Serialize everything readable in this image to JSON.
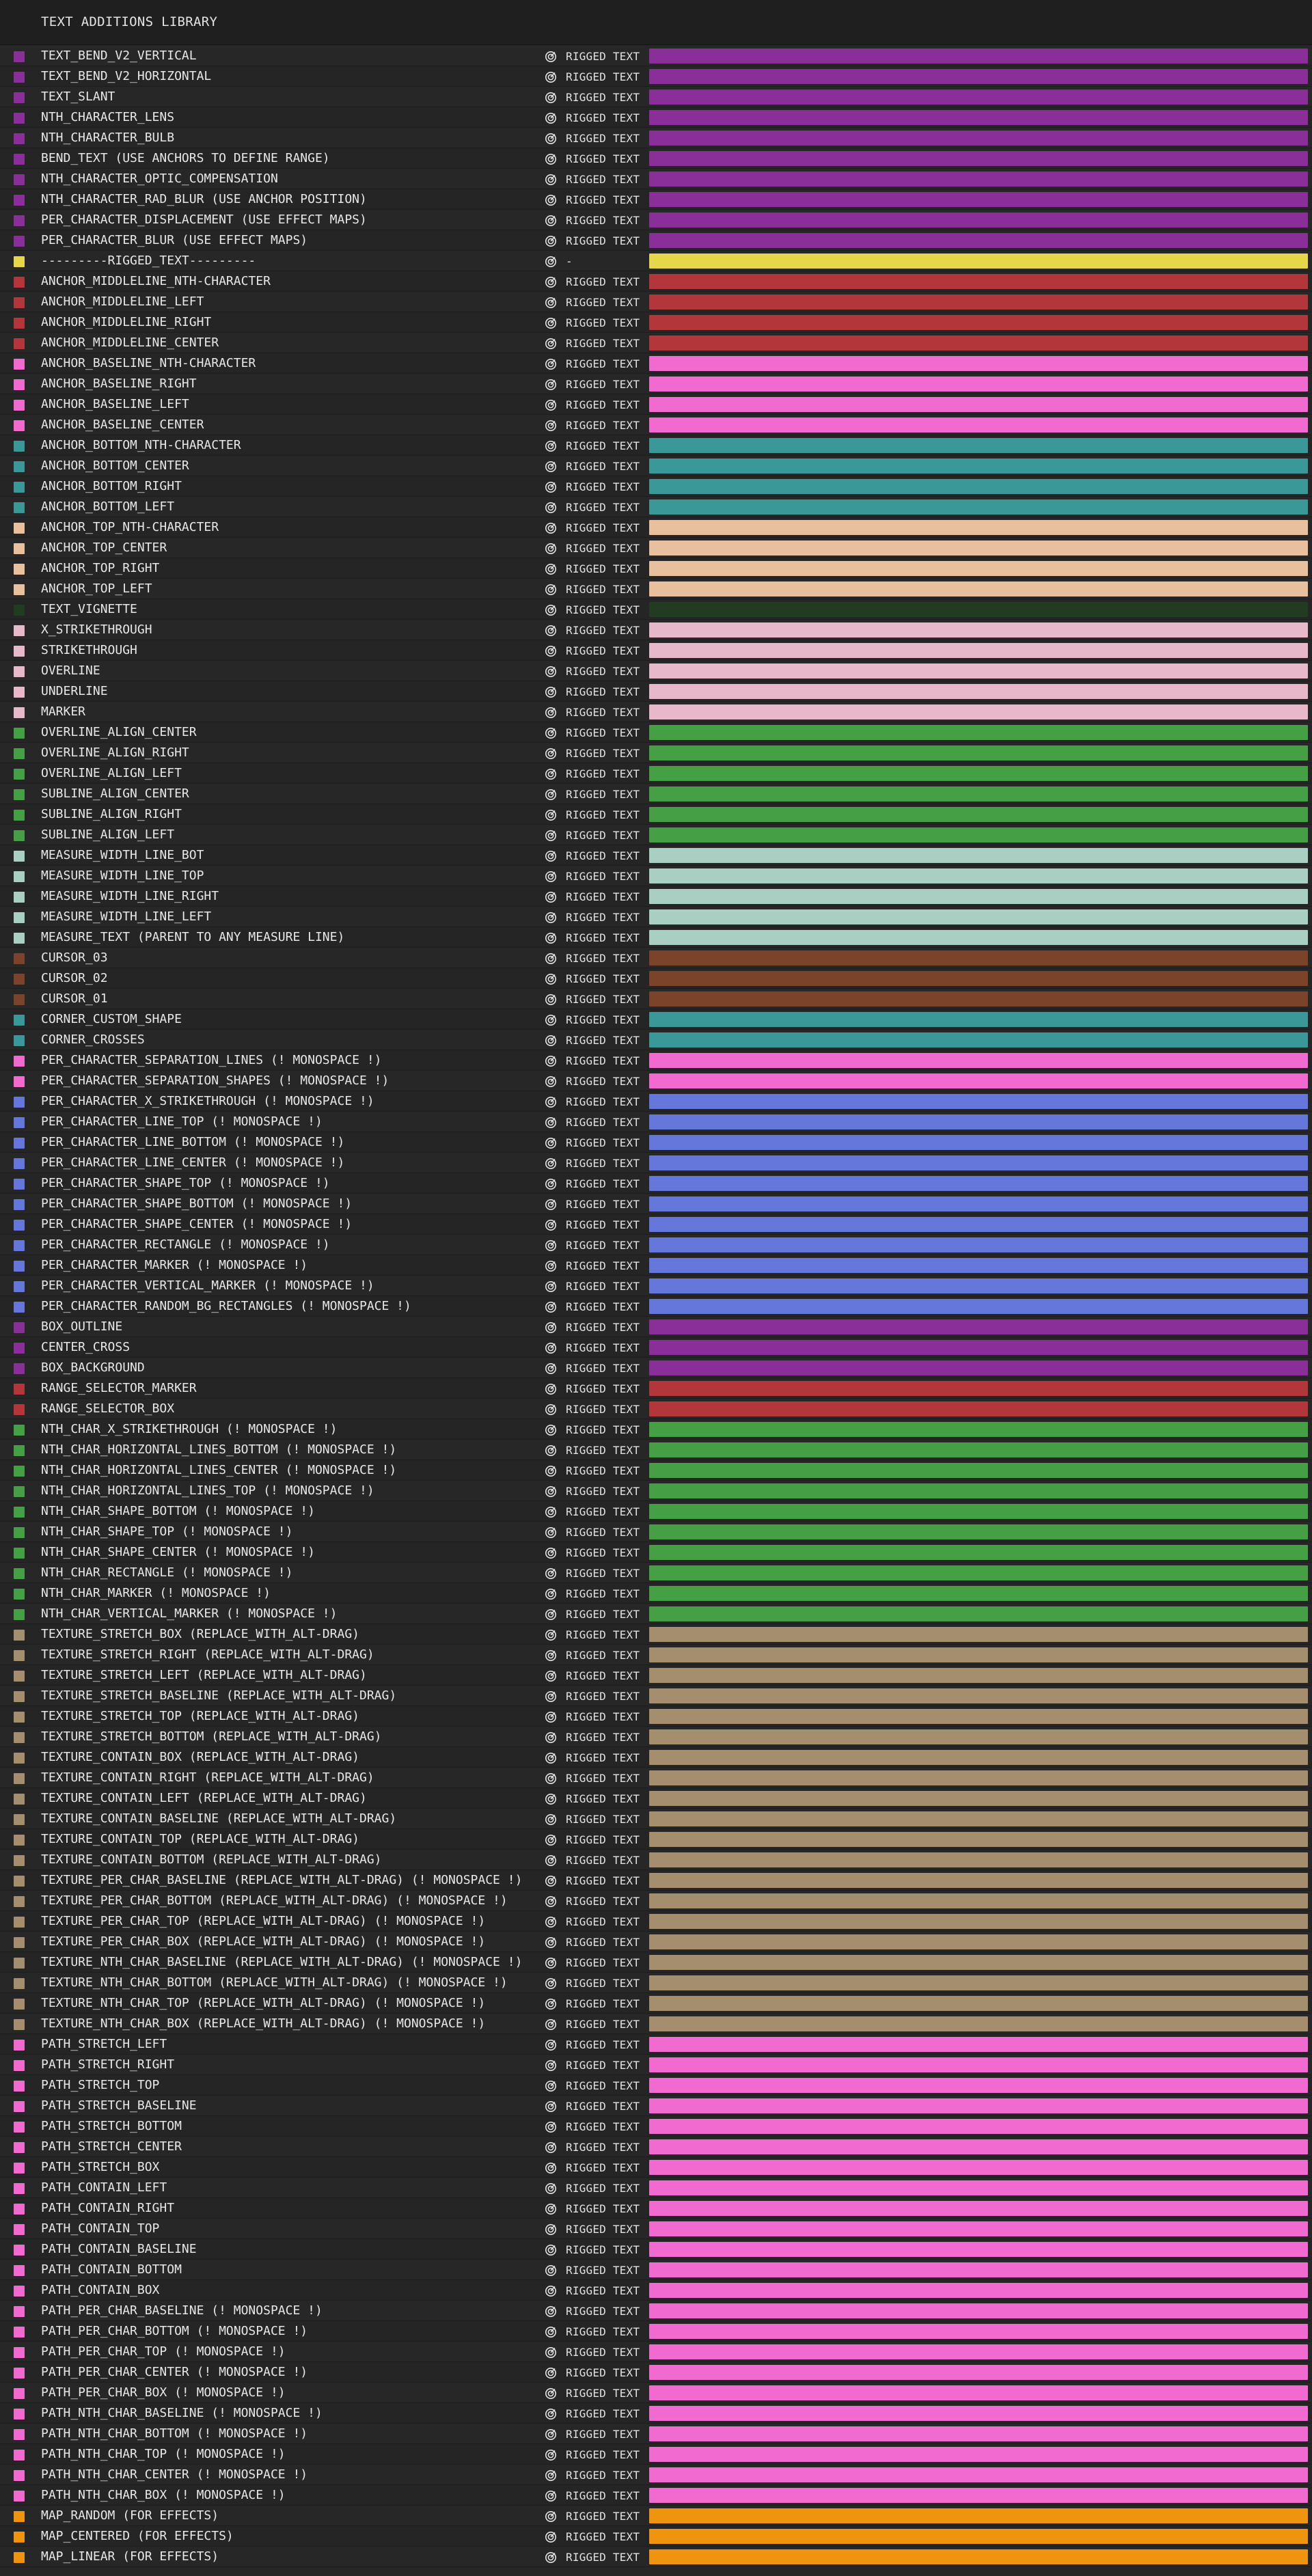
{
  "window": {
    "title": "TEXT ADDITIONS LIBRARY"
  },
  "palette": {
    "purple": "#8a2f9a",
    "yellow": "#e5d64a",
    "red": "#b3363a",
    "pink": "#f06ad0",
    "teal": "#3a9898",
    "peach": "#e9c09d",
    "darkgreen": "#213c21",
    "lightpink": "#e7b8c9",
    "green": "#45a045",
    "mint": "#a9cfc3",
    "brown": "#7b432a",
    "blue": "#6677dc",
    "tan": "#a58e6e",
    "orange": "#ee940f"
  },
  "items": [
    {
      "name": "TEXT_BEND_V2_VERTICAL",
      "type": "RIGGED TEXT",
      "color": "purple"
    },
    {
      "name": "TEXT_BEND_V2_HORIZONTAL",
      "type": "RIGGED TEXT",
      "color": "purple"
    },
    {
      "name": "TEXT_SLANT",
      "type": "RIGGED TEXT",
      "color": "purple"
    },
    {
      "name": "NTH_CHARACTER_LENS",
      "type": "RIGGED TEXT",
      "color": "purple"
    },
    {
      "name": "NTH_CHARACTER_BULB",
      "type": "RIGGED TEXT",
      "color": "purple"
    },
    {
      "name": "BEND_TEXT (USE ANCHORS TO DEFINE RANGE)",
      "type": "RIGGED TEXT",
      "color": "purple"
    },
    {
      "name": "NTH_CHARACTER_OPTIC_COMPENSATION",
      "type": "RIGGED TEXT",
      "color": "purple"
    },
    {
      "name": "NTH_CHARACTER_RAD_BLUR (USE ANCHOR POSITION)",
      "type": "RIGGED TEXT",
      "color": "purple"
    },
    {
      "name": "PER_CHARACTER_DISPLACEMENT (USE EFFECT MAPS)",
      "type": "RIGGED TEXT",
      "color": "purple"
    },
    {
      "name": "PER_CHARACTER_BLUR (USE EFFECT MAPS)",
      "type": "RIGGED TEXT",
      "color": "purple"
    },
    {
      "name": "---------RIGGED_TEXT---------",
      "type": "-",
      "color": "yellow"
    },
    {
      "name": "ANCHOR_MIDDLELINE_NTH-CHARACTER",
      "type": "RIGGED TEXT",
      "color": "red"
    },
    {
      "name": "ANCHOR_MIDDLELINE_LEFT",
      "type": "RIGGED TEXT",
      "color": "red"
    },
    {
      "name": "ANCHOR_MIDDLELINE_RIGHT",
      "type": "RIGGED TEXT",
      "color": "red"
    },
    {
      "name": "ANCHOR_MIDDLELINE_CENTER",
      "type": "RIGGED TEXT",
      "color": "red"
    },
    {
      "name": "ANCHOR_BASELINE_NTH-CHARACTER",
      "type": "RIGGED TEXT",
      "color": "pink"
    },
    {
      "name": "ANCHOR_BASELINE_RIGHT",
      "type": "RIGGED TEXT",
      "color": "pink"
    },
    {
      "name": "ANCHOR_BASELINE_LEFT",
      "type": "RIGGED TEXT",
      "color": "pink"
    },
    {
      "name": "ANCHOR_BASELINE_CENTER",
      "type": "RIGGED TEXT",
      "color": "pink"
    },
    {
      "name": "ANCHOR_BOTTOM_NTH-CHARACTER",
      "type": "RIGGED TEXT",
      "color": "teal"
    },
    {
      "name": "ANCHOR_BOTTOM_CENTER",
      "type": "RIGGED TEXT",
      "color": "teal"
    },
    {
      "name": "ANCHOR_BOTTOM_RIGHT",
      "type": "RIGGED TEXT",
      "color": "teal"
    },
    {
      "name": "ANCHOR_BOTTOM_LEFT",
      "type": "RIGGED TEXT",
      "color": "teal"
    },
    {
      "name": "ANCHOR_TOP_NTH-CHARACTER",
      "type": "RIGGED TEXT",
      "color": "peach"
    },
    {
      "name": "ANCHOR_TOP_CENTER",
      "type": "RIGGED TEXT",
      "color": "peach"
    },
    {
      "name": "ANCHOR_TOP_RIGHT",
      "type": "RIGGED TEXT",
      "color": "peach"
    },
    {
      "name": "ANCHOR_TOP_LEFT",
      "type": "RIGGED TEXT",
      "color": "peach"
    },
    {
      "name": "TEXT_VIGNETTE",
      "type": "RIGGED TEXT",
      "color": "darkgreen"
    },
    {
      "name": "X_STRIKETHROUGH",
      "type": "RIGGED TEXT",
      "color": "lightpink"
    },
    {
      "name": "STRIKETHROUGH",
      "type": "RIGGED TEXT",
      "color": "lightpink"
    },
    {
      "name": "OVERLINE",
      "type": "RIGGED TEXT",
      "color": "lightpink"
    },
    {
      "name": "UNDERLINE",
      "type": "RIGGED TEXT",
      "color": "lightpink"
    },
    {
      "name": "MARKER",
      "type": "RIGGED TEXT",
      "color": "lightpink"
    },
    {
      "name": "OVERLINE_ALIGN_CENTER",
      "type": "RIGGED TEXT",
      "color": "green"
    },
    {
      "name": "OVERLINE_ALIGN_RIGHT",
      "type": "RIGGED TEXT",
      "color": "green"
    },
    {
      "name": "OVERLINE_ALIGN_LEFT",
      "type": "RIGGED TEXT",
      "color": "green"
    },
    {
      "name": "SUBLINE_ALIGN_CENTER",
      "type": "RIGGED TEXT",
      "color": "green"
    },
    {
      "name": "SUBLINE_ALIGN_RIGHT",
      "type": "RIGGED TEXT",
      "color": "green"
    },
    {
      "name": "SUBLINE_ALIGN_LEFT",
      "type": "RIGGED TEXT",
      "color": "green"
    },
    {
      "name": "MEASURE_WIDTH_LINE_BOT",
      "type": "RIGGED TEXT",
      "color": "mint"
    },
    {
      "name": "MEASURE_WIDTH_LINE_TOP",
      "type": "RIGGED TEXT",
      "color": "mint"
    },
    {
      "name": "MEASURE_WIDTH_LINE_RIGHT",
      "type": "RIGGED TEXT",
      "color": "mint"
    },
    {
      "name": "MEASURE_WIDTH_LINE_LEFT",
      "type": "RIGGED TEXT",
      "color": "mint"
    },
    {
      "name": "MEASURE_TEXT (PARENT TO ANY MEASURE LINE)",
      "type": "RIGGED TEXT",
      "color": "mint"
    },
    {
      "name": "CURSOR_03",
      "type": "RIGGED TEXT",
      "color": "brown"
    },
    {
      "name": "CURSOR_02",
      "type": "RIGGED TEXT",
      "color": "brown"
    },
    {
      "name": "CURSOR_01",
      "type": "RIGGED TEXT",
      "color": "brown"
    },
    {
      "name": "CORNER_CUSTOM_SHAPE",
      "type": "RIGGED TEXT",
      "color": "teal"
    },
    {
      "name": "CORNER_CROSSES",
      "type": "RIGGED TEXT",
      "color": "teal"
    },
    {
      "name": "PER_CHARACTER_SEPARATION_LINES (! MONOSPACE !)",
      "type": "RIGGED TEXT",
      "color": "pink"
    },
    {
      "name": "PER_CHARACTER_SEPARATION_SHAPES (! MONOSPACE !)",
      "type": "RIGGED TEXT",
      "color": "pink"
    },
    {
      "name": "PER_CHARACTER_X_STRIKETHROUGH (! MONOSPACE !)",
      "type": "RIGGED TEXT",
      "color": "blue"
    },
    {
      "name": "PER_CHARACTER_LINE_TOP (! MONOSPACE !)",
      "type": "RIGGED TEXT",
      "color": "blue"
    },
    {
      "name": "PER_CHARACTER_LINE_BOTTOM (! MONOSPACE !)",
      "type": "RIGGED TEXT",
      "color": "blue"
    },
    {
      "name": "PER_CHARACTER_LINE_CENTER (! MONOSPACE !)",
      "type": "RIGGED TEXT",
      "color": "blue"
    },
    {
      "name": "PER_CHARACTER_SHAPE_TOP (! MONOSPACE !)",
      "type": "RIGGED TEXT",
      "color": "blue"
    },
    {
      "name": "PER_CHARACTER_SHAPE_BOTTOM (! MONOSPACE !)",
      "type": "RIGGED TEXT",
      "color": "blue"
    },
    {
      "name": "PER_CHARACTER_SHAPE_CENTER (! MONOSPACE !)",
      "type": "RIGGED TEXT",
      "color": "blue"
    },
    {
      "name": "PER_CHARACTER_RECTANGLE (! MONOSPACE !)",
      "type": "RIGGED TEXT",
      "color": "blue"
    },
    {
      "name": "PER_CHARACTER_MARKER (! MONOSPACE !)",
      "type": "RIGGED TEXT",
      "color": "blue"
    },
    {
      "name": "PER_CHARACTER_VERTICAL_MARKER (! MONOSPACE !)",
      "type": "RIGGED TEXT",
      "color": "blue"
    },
    {
      "name": "PER_CHARACTER_RANDOM_BG_RECTANGLES (! MONOSPACE !)",
      "type": "RIGGED TEXT",
      "color": "blue"
    },
    {
      "name": "BOX_OUTLINE",
      "type": "RIGGED TEXT",
      "color": "purple"
    },
    {
      "name": "CENTER_CROSS",
      "type": "RIGGED TEXT",
      "color": "purple"
    },
    {
      "name": "BOX_BACKGROUND",
      "type": "RIGGED TEXT",
      "color": "purple"
    },
    {
      "name": "RANGE_SELECTOR_MARKER",
      "type": "RIGGED TEXT",
      "color": "red"
    },
    {
      "name": "RANGE_SELECTOR_BOX",
      "type": "RIGGED TEXT",
      "color": "red"
    },
    {
      "name": "NTH_CHAR_X_STRIKETHROUGH (! MONOSPACE !)",
      "type": "RIGGED TEXT",
      "color": "green"
    },
    {
      "name": "NTH_CHAR_HORIZONTAL_LINES_BOTTOM (! MONOSPACE !)",
      "type": "RIGGED TEXT",
      "color": "green"
    },
    {
      "name": "NTH_CHAR_HORIZONTAL_LINES_CENTER (! MONOSPACE !)",
      "type": "RIGGED TEXT",
      "color": "green"
    },
    {
      "name": "NTH_CHAR_HORIZONTAL_LINES_TOP (! MONOSPACE !)",
      "type": "RIGGED TEXT",
      "color": "green"
    },
    {
      "name": "NTH_CHAR_SHAPE_BOTTOM (! MONOSPACE !)",
      "type": "RIGGED TEXT",
      "color": "green"
    },
    {
      "name": "NTH_CHAR_SHAPE_TOP (! MONOSPACE !)",
      "type": "RIGGED TEXT",
      "color": "green"
    },
    {
      "name": "NTH_CHAR_SHAPE_CENTER (! MONOSPACE !)",
      "type": "RIGGED TEXT",
      "color": "green"
    },
    {
      "name": "NTH_CHAR_RECTANGLE (! MONOSPACE !)",
      "type": "RIGGED TEXT",
      "color": "green"
    },
    {
      "name": "NTH_CHAR_MARKER (! MONOSPACE !)",
      "type": "RIGGED TEXT",
      "color": "green"
    },
    {
      "name": "NTH_CHAR_VERTICAL_MARKER (! MONOSPACE !)",
      "type": "RIGGED TEXT",
      "color": "green"
    },
    {
      "name": "TEXTURE_STRETCH_BOX (REPLACE_WITH_ALT-DRAG)",
      "type": "RIGGED TEXT",
      "color": "tan"
    },
    {
      "name": "TEXTURE_STRETCH_RIGHT (REPLACE_WITH_ALT-DRAG)",
      "type": "RIGGED TEXT",
      "color": "tan"
    },
    {
      "name": "TEXTURE_STRETCH_LEFT (REPLACE_WITH_ALT-DRAG)",
      "type": "RIGGED TEXT",
      "color": "tan"
    },
    {
      "name": "TEXTURE_STRETCH_BASELINE (REPLACE_WITH_ALT-DRAG)",
      "type": "RIGGED TEXT",
      "color": "tan"
    },
    {
      "name": "TEXTURE_STRETCH_TOP (REPLACE_WITH_ALT-DRAG)",
      "type": "RIGGED TEXT",
      "color": "tan"
    },
    {
      "name": "TEXTURE_STRETCH_BOTTOM (REPLACE_WITH_ALT-DRAG)",
      "type": "RIGGED TEXT",
      "color": "tan"
    },
    {
      "name": "TEXTURE_CONTAIN_BOX (REPLACE_WITH_ALT-DRAG)",
      "type": "RIGGED TEXT",
      "color": "tan"
    },
    {
      "name": "TEXTURE_CONTAIN_RIGHT (REPLACE_WITH_ALT-DRAG)",
      "type": "RIGGED TEXT",
      "color": "tan"
    },
    {
      "name": "TEXTURE_CONTAIN_LEFT (REPLACE_WITH_ALT-DRAG)",
      "type": "RIGGED TEXT",
      "color": "tan"
    },
    {
      "name": "TEXTURE_CONTAIN_BASELINE (REPLACE_WITH_ALT-DRAG)",
      "type": "RIGGED TEXT",
      "color": "tan"
    },
    {
      "name": "TEXTURE_CONTAIN_TOP (REPLACE_WITH_ALT-DRAG)",
      "type": "RIGGED TEXT",
      "color": "tan"
    },
    {
      "name": "TEXTURE_CONTAIN_BOTTOM (REPLACE_WITH_ALT-DRAG)",
      "type": "RIGGED TEXT",
      "color": "tan"
    },
    {
      "name": "TEXTURE_PER_CHAR_BASELINE (REPLACE_WITH_ALT-DRAG) (! MONOSPACE !)",
      "type": "RIGGED TEXT",
      "color": "tan"
    },
    {
      "name": "TEXTURE_PER_CHAR_BOTTOM (REPLACE_WITH_ALT-DRAG) (! MONOSPACE !)",
      "type": "RIGGED TEXT",
      "color": "tan"
    },
    {
      "name": "TEXTURE_PER_CHAR_TOP (REPLACE_WITH_ALT-DRAG) (! MONOSPACE !)",
      "type": "RIGGED TEXT",
      "color": "tan"
    },
    {
      "name": "TEXTURE_PER_CHAR_BOX (REPLACE_WITH_ALT-DRAG) (! MONOSPACE !)",
      "type": "RIGGED TEXT",
      "color": "tan"
    },
    {
      "name": "TEXTURE_NTH_CHAR_BASELINE (REPLACE_WITH_ALT-DRAG) (! MONOSPACE !)",
      "type": "RIGGED TEXT",
      "color": "tan"
    },
    {
      "name": "TEXTURE_NTH_CHAR_BOTTOM (REPLACE_WITH_ALT-DRAG) (! MONOSPACE !)",
      "type": "RIGGED TEXT",
      "color": "tan"
    },
    {
      "name": "TEXTURE_NTH_CHAR_TOP (REPLACE_WITH_ALT-DRAG) (! MONOSPACE !)",
      "type": "RIGGED TEXT",
      "color": "tan"
    },
    {
      "name": "TEXTURE_NTH_CHAR_BOX (REPLACE_WITH_ALT-DRAG) (! MONOSPACE !)",
      "type": "RIGGED TEXT",
      "color": "tan"
    },
    {
      "name": "PATH_STRETCH_LEFT",
      "type": "RIGGED TEXT",
      "color": "pink"
    },
    {
      "name": "PATH_STRETCH_RIGHT",
      "type": "RIGGED TEXT",
      "color": "pink"
    },
    {
      "name": "PATH_STRETCH_TOP",
      "type": "RIGGED TEXT",
      "color": "pink"
    },
    {
      "name": "PATH_STRETCH_BASELINE",
      "type": "RIGGED TEXT",
      "color": "pink"
    },
    {
      "name": "PATH_STRETCH_BOTTOM",
      "type": "RIGGED TEXT",
      "color": "pink"
    },
    {
      "name": "PATH_STRETCH_CENTER",
      "type": "RIGGED TEXT",
      "color": "pink"
    },
    {
      "name": "PATH_STRETCH_BOX",
      "type": "RIGGED TEXT",
      "color": "pink"
    },
    {
      "name": "PATH_CONTAIN_LEFT",
      "type": "RIGGED TEXT",
      "color": "pink"
    },
    {
      "name": "PATH_CONTAIN_RIGHT",
      "type": "RIGGED TEXT",
      "color": "pink"
    },
    {
      "name": "PATH_CONTAIN_TOP",
      "type": "RIGGED TEXT",
      "color": "pink"
    },
    {
      "name": "PATH_CONTAIN_BASELINE",
      "type": "RIGGED TEXT",
      "color": "pink"
    },
    {
      "name": "PATH_CONTAIN_BOTTOM",
      "type": "RIGGED TEXT",
      "color": "pink"
    },
    {
      "name": "PATH_CONTAIN_BOX",
      "type": "RIGGED TEXT",
      "color": "pink"
    },
    {
      "name": "PATH_PER_CHAR_BASELINE (! MONOSPACE !)",
      "type": "RIGGED TEXT",
      "color": "pink"
    },
    {
      "name": "PATH_PER_CHAR_BOTTOM (! MONOSPACE !)",
      "type": "RIGGED TEXT",
      "color": "pink"
    },
    {
      "name": "PATH_PER_CHAR_TOP (! MONOSPACE !)",
      "type": "RIGGED TEXT",
      "color": "pink"
    },
    {
      "name": "PATH_PER_CHAR_CENTER (! MONOSPACE !)",
      "type": "RIGGED TEXT",
      "color": "pink"
    },
    {
      "name": "PATH_PER_CHAR_BOX (! MONOSPACE !)",
      "type": "RIGGED TEXT",
      "color": "pink"
    },
    {
      "name": "PATH_NTH_CHAR_BASELINE (! MONOSPACE !)",
      "type": "RIGGED TEXT",
      "color": "pink"
    },
    {
      "name": "PATH_NTH_CHAR_BOTTOM (! MONOSPACE !)",
      "type": "RIGGED TEXT",
      "color": "pink"
    },
    {
      "name": "PATH_NTH_CHAR_TOP (! MONOSPACE !)",
      "type": "RIGGED TEXT",
      "color": "pink"
    },
    {
      "name": "PATH_NTH_CHAR_CENTER (! MONOSPACE !)",
      "type": "RIGGED TEXT",
      "color": "pink"
    },
    {
      "name": "PATH_NTH_CHAR_BOX (! MONOSPACE !)",
      "type": "RIGGED TEXT",
      "color": "pink"
    },
    {
      "name": "MAP_RANDOM (FOR EFFECTS)",
      "type": "RIGGED TEXT",
      "color": "orange"
    },
    {
      "name": "MAP_CENTERED (FOR EFFECTS)",
      "type": "RIGGED TEXT",
      "color": "orange"
    },
    {
      "name": "MAP_LINEAR (FOR EFFECTS)",
      "type": "RIGGED TEXT",
      "color": "orange"
    }
  ]
}
